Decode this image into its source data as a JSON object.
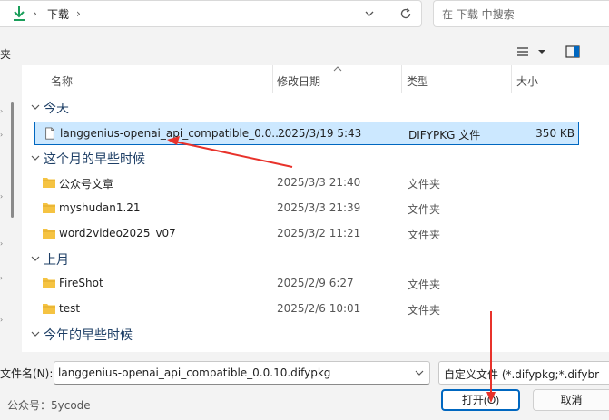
{
  "address_bar": {
    "crumb": "下载"
  },
  "search": {
    "placeholder": "在 下载 中搜索"
  },
  "toolbar": {
    "left_fragment": "夹"
  },
  "columns": {
    "name": "名称",
    "date": "修改日期",
    "type": "类型",
    "size": "大小"
  },
  "groups": [
    {
      "label": "今天",
      "rows": [
        {
          "name": "langgenius-openai_api_compatible_0.0....",
          "date": "2025/3/19 5:43",
          "type": "DIFYPKG 文件",
          "size": "350 KB",
          "icon": "file-icon",
          "selected": true
        }
      ]
    },
    {
      "label": "这个月的早些时候",
      "rows": [
        {
          "name": "公众号文章",
          "date": "2025/3/3 21:40",
          "type": "文件夹",
          "size": "",
          "icon": "folder-icon"
        },
        {
          "name": "myshudan1.21",
          "date": "2025/3/3 21:39",
          "type": "文件夹",
          "size": "",
          "icon": "folder-icon"
        },
        {
          "name": "word2video2025_v07",
          "date": "2025/3/2 11:21",
          "type": "文件夹",
          "size": "",
          "icon": "folder-icon"
        }
      ]
    },
    {
      "label": "上月",
      "rows": [
        {
          "name": "FireShot",
          "date": "2025/2/9 6:27",
          "type": "文件夹",
          "size": "",
          "icon": "folder-icon"
        },
        {
          "name": "test",
          "date": "2025/2/6 10:01",
          "type": "文件夹",
          "size": "",
          "icon": "folder-icon"
        }
      ]
    },
    {
      "label": "今年的早些时候",
      "rows": []
    }
  ],
  "bottom": {
    "filename_label": "文件名(N):",
    "filename_value": "langgenius-openai_api_compatible_0.0.10.difypkg",
    "filter_value": "自定义文件 (*.difypkg;*.difybr",
    "open_label": "打开(O)",
    "cancel_label": "取消",
    "watermark": "公众号：5ycode"
  },
  "colors": {
    "accent": "#0067c0",
    "selection": "#cce8ff",
    "folder": "#f5c342",
    "annotation": "#e8322b",
    "download_arrow": "#1a9e5a"
  }
}
